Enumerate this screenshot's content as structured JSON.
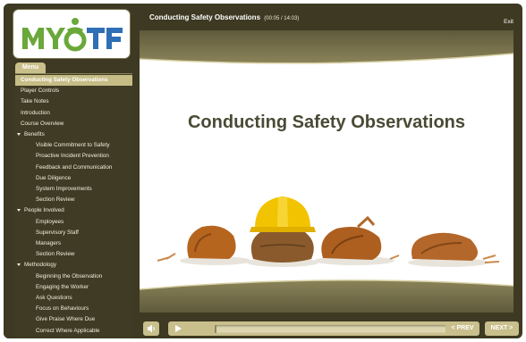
{
  "header": {
    "title": "Conducting Safety Observations",
    "time": "(00:05 / 14:03)",
    "exit_label": "Exit"
  },
  "logo": {
    "text": "MYOTF"
  },
  "menu": {
    "tab_label": "Menu",
    "items": [
      {
        "label": "Conducting Safety Observations",
        "level": 0,
        "selected": true
      },
      {
        "label": "Player Controls",
        "level": 0
      },
      {
        "label": "Take Notes",
        "level": 0
      },
      {
        "label": "Introduction",
        "level": 0
      },
      {
        "label": "Course Overview",
        "level": 0
      },
      {
        "label": "Benefits",
        "level": 0,
        "expanded": true
      },
      {
        "label": "Visible Commitment to Safety",
        "level": 1
      },
      {
        "label": "Proactive Incident Prevention",
        "level": 1
      },
      {
        "label": "Feedback and Communication",
        "level": 1
      },
      {
        "label": "Due Diligence",
        "level": 1
      },
      {
        "label": "System Improvements",
        "level": 1
      },
      {
        "label": "Section Review",
        "level": 1
      },
      {
        "label": "People Involved",
        "level": 0,
        "expanded": true
      },
      {
        "label": "Employees",
        "level": 1
      },
      {
        "label": "Supervisory Staff",
        "level": 1
      },
      {
        "label": "Managers",
        "level": 1
      },
      {
        "label": "Section Review",
        "level": 1
      },
      {
        "label": "Methodology",
        "level": 0,
        "expanded": true
      },
      {
        "label": "Beginning the Observation",
        "level": 1
      },
      {
        "label": "Engaging the Worker",
        "level": 1
      },
      {
        "label": "Ask Questions",
        "level": 1
      },
      {
        "label": "Focus on Behaviours",
        "level": 1
      },
      {
        "label": "Give Praise Where Due",
        "level": 1
      },
      {
        "label": "Correct Where Applicable",
        "level": 1
      }
    ]
  },
  "slide": {
    "title": "Conducting Safety Observations"
  },
  "controls": {
    "prev_label": "< PREV",
    "next_label": "NEXT >",
    "progress": 0.006
  },
  "colors": {
    "frame": "#3d3922",
    "accent": "#c8bf8c",
    "logo_green": "#6aa83a",
    "logo_blue": "#2e6fb5",
    "hardhat": "#f2c300"
  }
}
